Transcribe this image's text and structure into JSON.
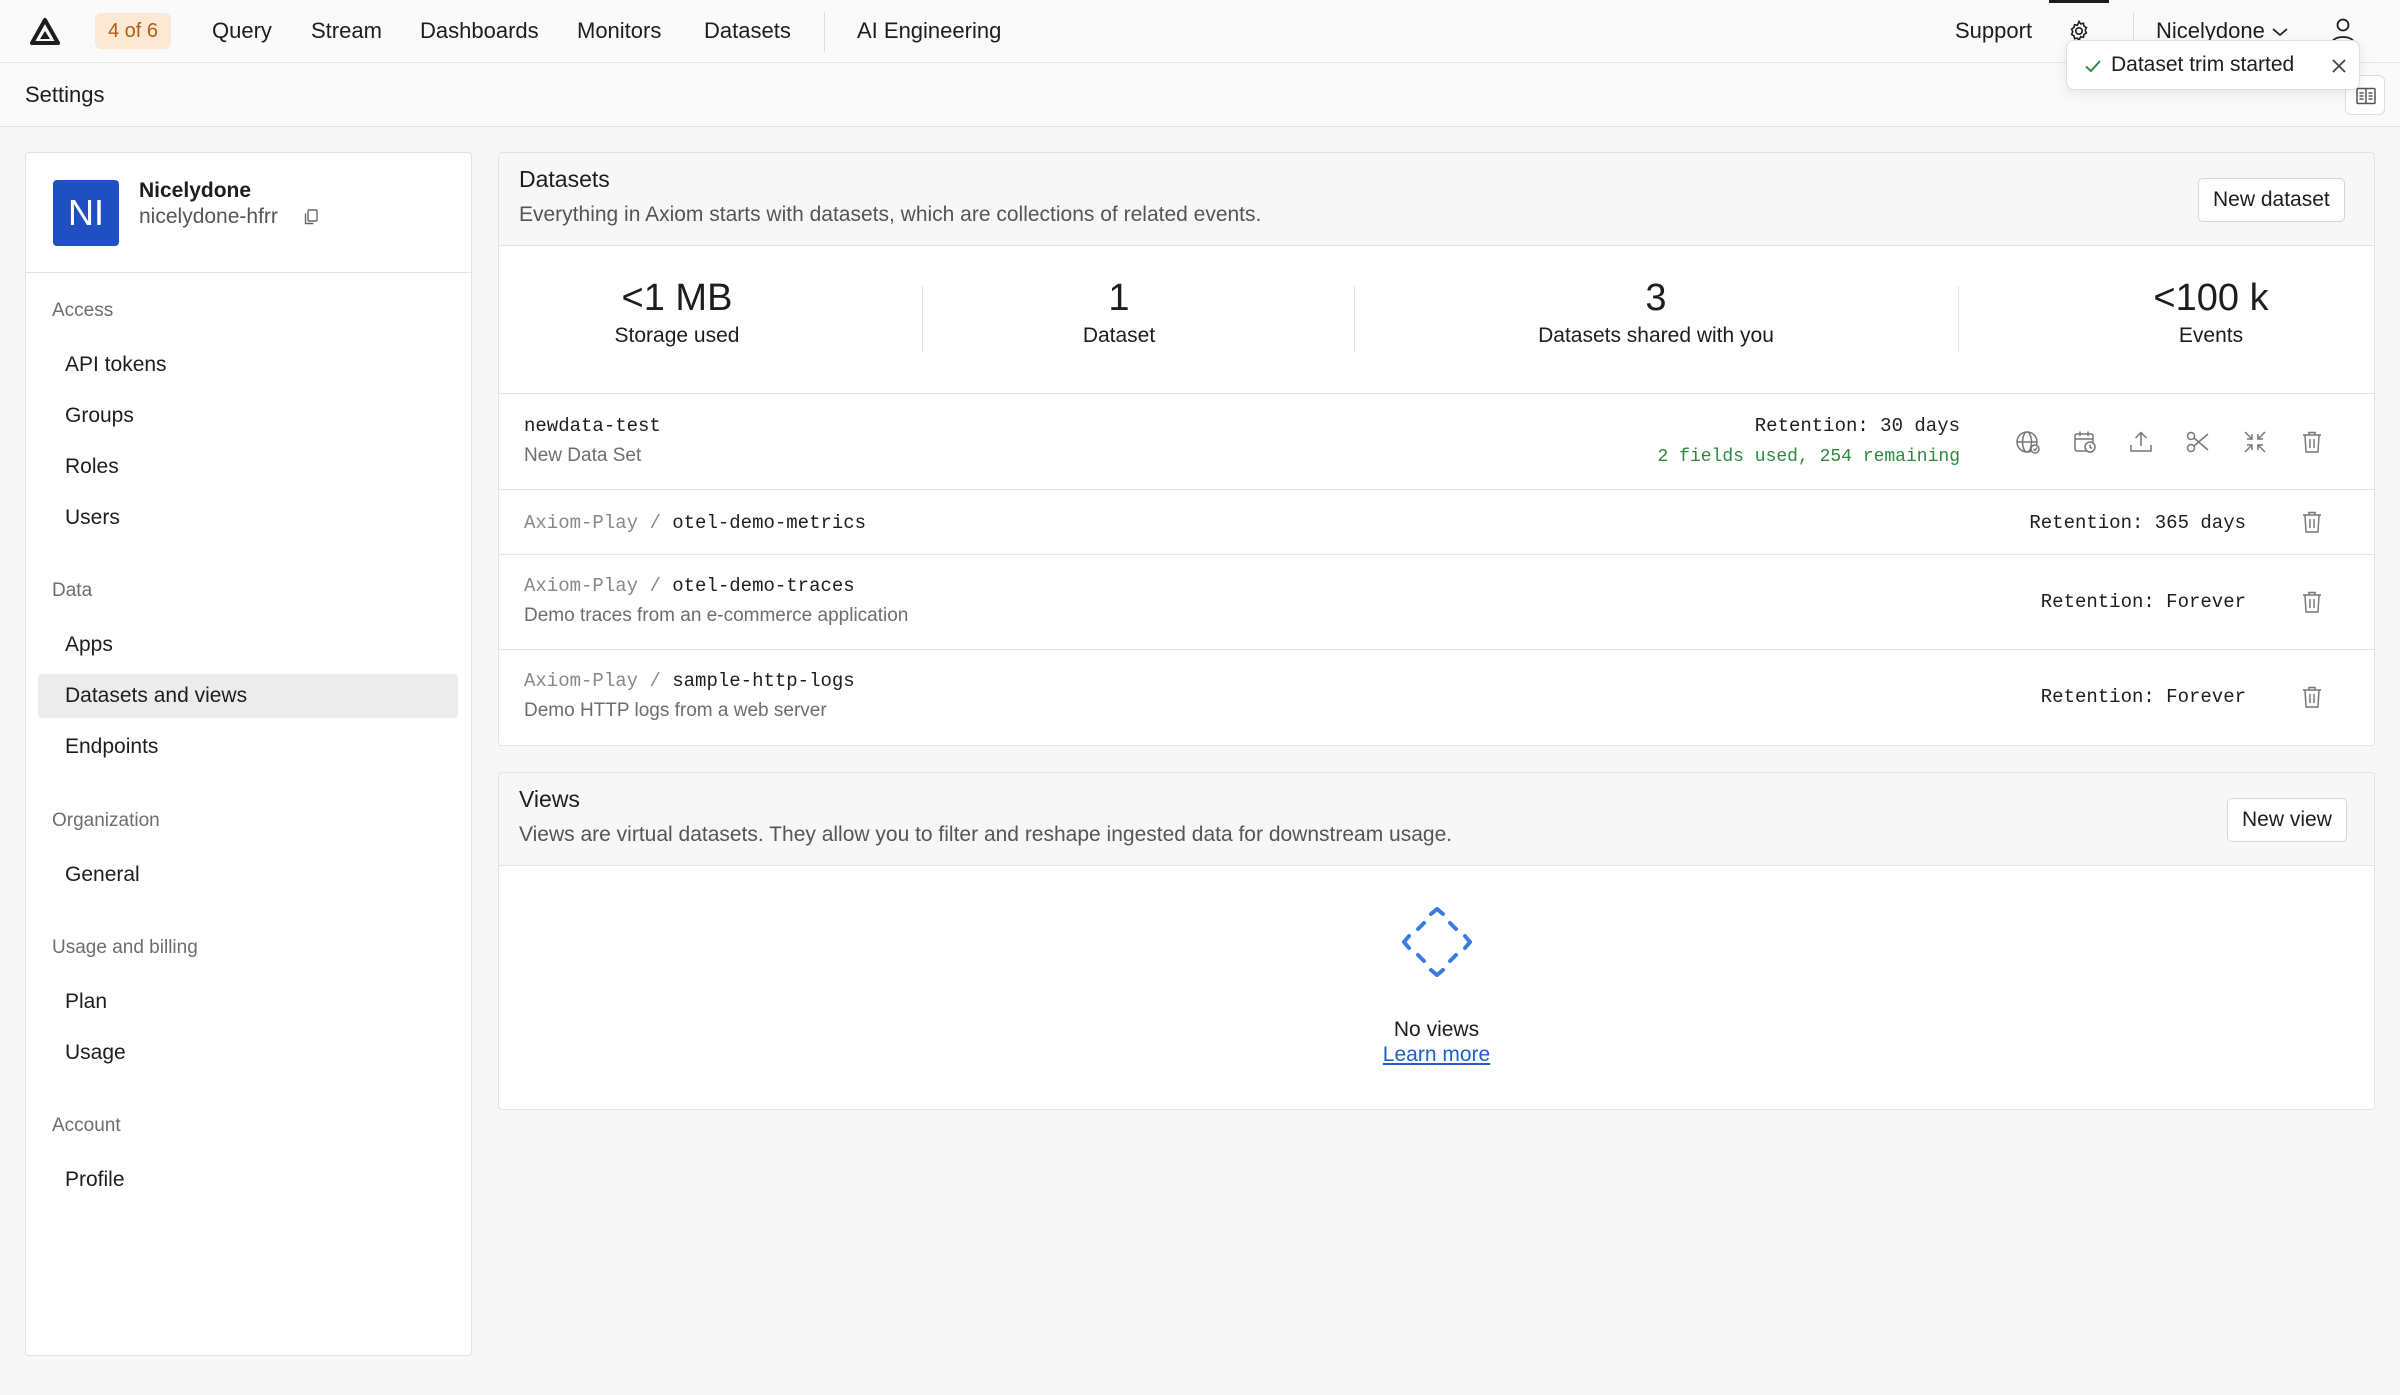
{
  "nav": {
    "badge": "4 of 6",
    "items": [
      "Query",
      "Stream",
      "Dashboards",
      "Monitors",
      "Datasets",
      "AI Engineering"
    ],
    "support": "Support",
    "user": "Nicelydone"
  },
  "toast": {
    "message": "Dataset trim started"
  },
  "subheader": {
    "title": "Settings"
  },
  "sidebar": {
    "org_initials": "NI",
    "org_name": "Nicelydone",
    "org_slug": "nicelydone-hfrr",
    "sections": [
      {
        "label": "Access",
        "items": [
          "API tokens",
          "Groups",
          "Roles",
          "Users"
        ]
      },
      {
        "label": "Data",
        "items": [
          "Apps",
          "Datasets and views",
          "Endpoints"
        ]
      },
      {
        "label": "Organization",
        "items": [
          "General"
        ]
      },
      {
        "label": "Usage and billing",
        "items": [
          "Plan",
          "Usage"
        ]
      },
      {
        "label": "Account",
        "items": [
          "Profile"
        ]
      }
    ],
    "active_item": "Datasets and views"
  },
  "datasets": {
    "title": "Datasets",
    "description": "Everything in Axiom starts with datasets, which are collections of related events.",
    "new_button": "New dataset",
    "stats": [
      {
        "value": "<1 MB",
        "label": "Storage used"
      },
      {
        "value": "1",
        "label": "Dataset"
      },
      {
        "value": "3",
        "label": "Datasets shared with you"
      },
      {
        "value": "<100 k",
        "label": "Events"
      }
    ],
    "rows": [
      {
        "namespace": "",
        "name": "newdata-test",
        "description": "New Data Set",
        "retention": "Retention: 30 days",
        "fields": "2 fields used, 254 remaining"
      },
      {
        "namespace": "Axiom-Play",
        "name": "otel-demo-metrics",
        "description": "",
        "retention": "Retention: 365 days",
        "fields": ""
      },
      {
        "namespace": "Axiom-Play",
        "name": "otel-demo-traces",
        "description": "Demo traces from an e-commerce application",
        "retention": "Retention: Forever",
        "fields": ""
      },
      {
        "namespace": "Axiom-Play",
        "name": "sample-http-logs",
        "description": "Demo HTTP logs from a web server",
        "retention": "Retention: Forever",
        "fields": ""
      }
    ],
    "separator": "/"
  },
  "views": {
    "title": "Views",
    "description": "Views are virtual datasets. They allow you to filter and reshape ingested data for downstream usage.",
    "new_button": "New view",
    "empty_title": "No views",
    "empty_link": "Learn more"
  },
  "colors": {
    "accent": "#1f4fc1",
    "badge_bg": "#fbe9d6",
    "badge_text": "#b35c10",
    "fields_text": "#2d8a3e",
    "link": "#1f5fc9"
  }
}
